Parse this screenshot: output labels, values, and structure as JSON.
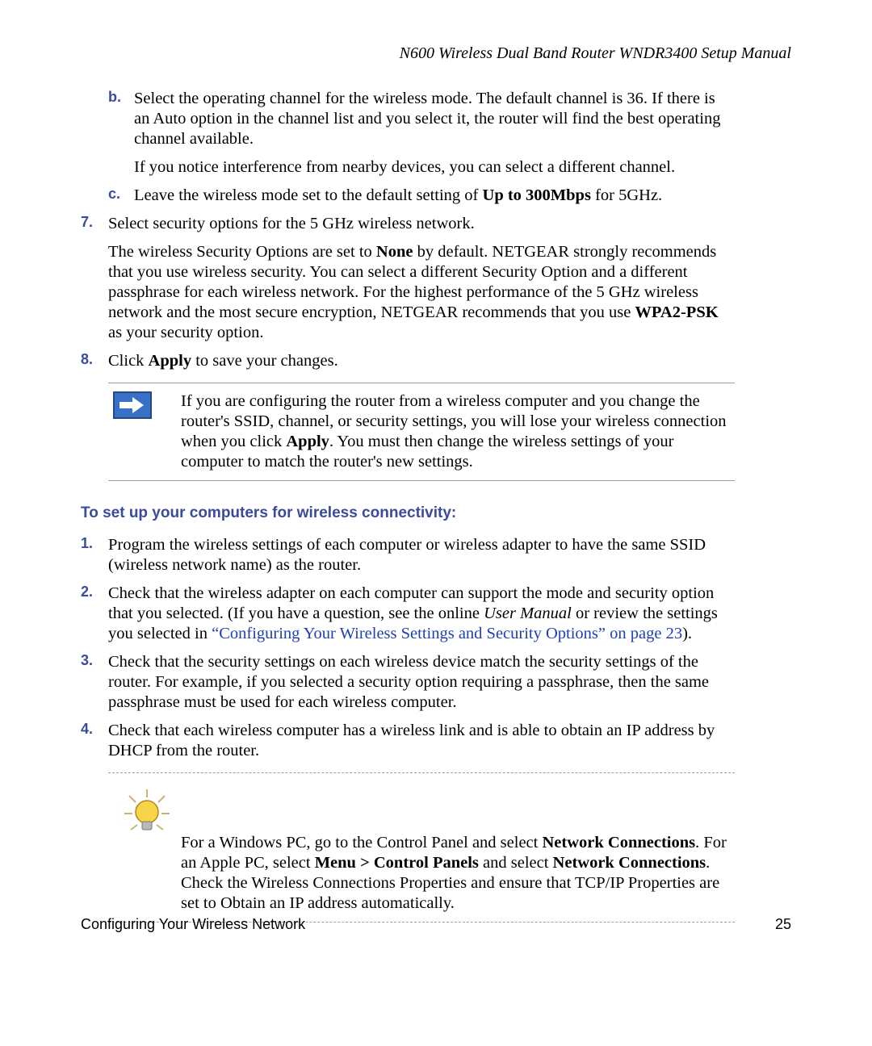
{
  "doc_header": "N600 Wireless Dual Band Router WNDR3400 Setup Manual",
  "sub_b_letter": "b.",
  "sub_b_p1": "Select the operating channel for the wireless mode. The default channel is 36. If there is an Auto option in the channel list and you select it, the router will find the best operating channel available.",
  "sub_b_p2": "If you notice interference from nearby devices, you can select a different channel.",
  "sub_c_letter": "c.",
  "sub_c_pre": "Leave the wireless mode set to the default setting of ",
  "sub_c_bold": "Up to 300Mbps",
  "sub_c_post": " for 5GHz.",
  "step7_num": "7.",
  "step7_p1": "Select security options for the 5 GHz wireless network.",
  "step7_p2_pre": "The wireless Security Options are set to ",
  "step7_p2_b1": "None",
  "step7_p2_mid": " by default. NETGEAR strongly recommends that you use wireless security. You can select a different Security Option and a different passphrase for each wireless network. For the highest performance of the 5 GHz wireless network and the most secure encryption, NETGEAR recommends that you use ",
  "step7_p2_b2": "WPA2-PSK",
  "step7_p2_post": " as your security option.",
  "step8_num": "8.",
  "step8_pre": "Click ",
  "step8_bold": "Apply",
  "step8_post": " to save your changes.",
  "note_pre": "If you are configuring the router from a wireless computer and you change the router's SSID, channel, or security settings, you will lose your wireless connection when you click ",
  "note_bold": "Apply",
  "note_post": ". You must then change the wireless settings of your computer to match the router's new settings.",
  "section_heading": "To set up your computers for wireless connectivity:",
  "c1_num": "1.",
  "c1_text": "Program the wireless settings of each computer or wireless adapter to have the same SSID (wireless network name) as the router.",
  "c2_num": "2.",
  "c2_pre": "Check that the wireless adapter on each computer can support the mode and security option that you selected. (If you have a question, see the online ",
  "c2_italic": "User Manual",
  "c2_mid": " or review the settings you selected in ",
  "c2_link": "“Configuring Your Wireless Settings and Security Options” on page 23",
  "c2_post": ").",
  "c3_num": "3.",
  "c3_text": "Check that the security settings on each wireless device match the security settings of the router. For example, if you selected a security option requiring a passphrase, then the same passphrase must be used for each wireless computer.",
  "c4_num": "4.",
  "c4_text": "Check that each wireless computer has a wireless link and is able to obtain an IP address by DHCP from the router.",
  "tip_l1_pre": "For a Windows PC, go to the Control Panel and select ",
  "tip_l1_b": "Network Connections",
  "tip_l1_post": ". For an Apple PC, select ",
  "tip_l2_b1": "Menu > Control Panels",
  "tip_l2_mid": " and select ",
  "tip_l2_b2": "Network Connections",
  "tip_l2_post": ".",
  "tip_l3": "Check the Wireless Connections Properties and ensure that TCP/IP Properties are set to Obtain an IP address automatically.",
  "footer_left": "Configuring Your Wireless Network",
  "footer_right": "25"
}
